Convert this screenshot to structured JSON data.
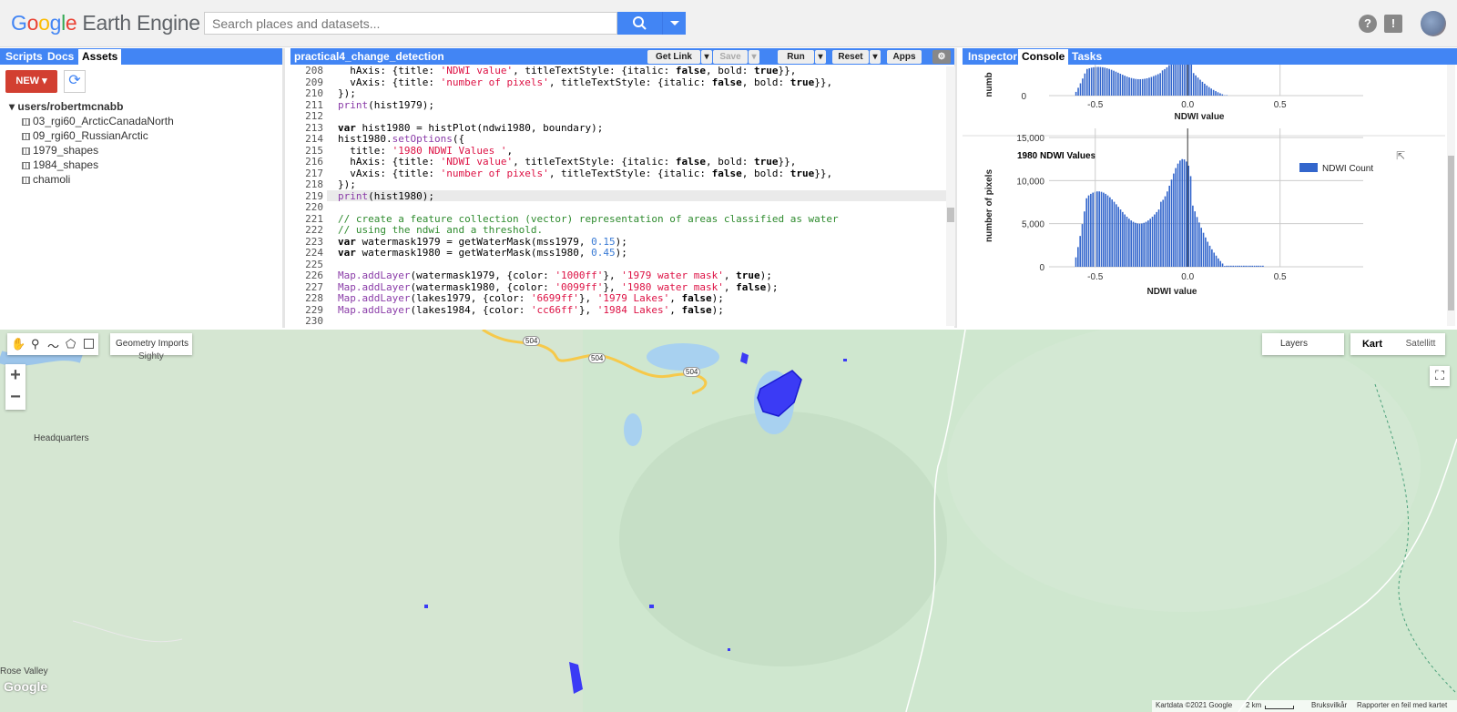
{
  "header": {
    "logo_google": "Google",
    "logo_ee": "Earth Engine",
    "search_placeholder": "Search places and datasets..."
  },
  "left": {
    "tabs": [
      "Scripts",
      "Docs",
      "Assets"
    ],
    "active_tab": "Assets",
    "new_label": "NEW",
    "root": "users/robertmcnabb",
    "items": [
      "03_rgi60_ArcticCanadaNorth",
      "09_rgi60_RussianArctic",
      "1979_shapes",
      "1984_shapes",
      "chamoli"
    ]
  },
  "editor": {
    "script_name": "practical4_change_detection",
    "buttons": {
      "getlink": "Get Link",
      "save": "Save",
      "run": "Run",
      "reset": "Reset",
      "apps": "Apps"
    },
    "lines": [
      {
        "n": "208",
        "html": "  hAxis: {title: <span class='str'>'NDWI value'</span>, titleTextStyle: {italic: <span class='kw'>false</span>, bold: <span class='kw'>true</span>}},"
      },
      {
        "n": "209",
        "html": "  vAxis: {title: <span class='str'>'number of pixels'</span>, titleTextStyle: {italic: <span class='kw'>false</span>, bold: <span class='kw'>true</span>}},"
      },
      {
        "n": "210",
        "html": "});"
      },
      {
        "n": "211",
        "html": "<span class='fn'>print</span>(hist1979);"
      },
      {
        "n": "212",
        "html": ""
      },
      {
        "n": "213",
        "html": "<span class='kw'>var</span> hist1980 = histPlot(ndwi1980, boundary);"
      },
      {
        "n": "214",
        "html": "hist1980.<span class='fn'>setOptions</span>({"
      },
      {
        "n": "215",
        "html": "  title: <span class='str'>'1980 NDWI Values '</span>,"
      },
      {
        "n": "216",
        "html": "  hAxis: {title: <span class='str'>'NDWI value'</span>, titleTextStyle: {italic: <span class='kw'>false</span>, bold: <span class='kw'>true</span>}},"
      },
      {
        "n": "217",
        "html": "  vAxis: {title: <span class='str'>'number of pixels'</span>, titleTextStyle: {italic: <span class='kw'>false</span>, bold: <span class='kw'>true</span>}},"
      },
      {
        "n": "218",
        "html": "});"
      },
      {
        "n": "219",
        "html": "<span class='fn'>print</span>(hist1980);"
      },
      {
        "n": "220",
        "html": ""
      },
      {
        "n": "221",
        "html": "<span class='cm'>// create a feature collection (vector) representation of areas classified as water</span>"
      },
      {
        "n": "222",
        "html": "<span class='cm'>// using the ndwi and a threshold.</span>"
      },
      {
        "n": "223",
        "html": "<span class='kw'>var</span> watermask1979 = getWaterMask(mss1979, <span class='num'>0.15</span>);"
      },
      {
        "n": "224",
        "html": "<span class='kw'>var</span> watermask1980 = getWaterMask(mss1980, <span class='num'>0.45</span>);"
      },
      {
        "n": "225",
        "html": ""
      },
      {
        "n": "226",
        "html": "<span class='fn'>Map.addLayer</span>(watermask1979, {color: <span class='str'>'1000ff'</span>}, <span class='str'>'1979 water mask'</span>, <span class='kw'>true</span>);"
      },
      {
        "n": "227",
        "html": "<span class='fn'>Map.addLayer</span>(watermask1980, {color: <span class='str'>'0099ff'</span>}, <span class='str'>'1980 water mask'</span>, <span class='kw'>false</span>);"
      },
      {
        "n": "228",
        "html": "<span class='fn'>Map.addLayer</span>(lakes1979, {color: <span class='str'>'6699ff'</span>}, <span class='str'>'1979 Lakes'</span>, <span class='kw'>false</span>);"
      },
      {
        "n": "229",
        "html": "<span class='fn'>Map.addLayer</span>(lakes1984, {color: <span class='str'>'cc66ff'</span>}, <span class='str'>'1984 Lakes'</span>, <span class='kw'>false</span>);"
      },
      {
        "n": "230",
        "html": ""
      }
    ]
  },
  "right": {
    "tabs": [
      "Inspector",
      "Console",
      "Tasks"
    ],
    "active_tab": "Console"
  },
  "chart_data": [
    {
      "type": "bar",
      "title": "",
      "xlabel": "NDWI value",
      "ylabel": "numb",
      "x_ticks": [
        "-0.5",
        "0.0",
        "0.5"
      ],
      "y_ticks": [
        "0"
      ],
      "partial": true
    },
    {
      "type": "bar",
      "title": "1980 NDWI Values",
      "xlabel": "NDWI value",
      "ylabel": "number of pixels",
      "legend": "NDWI Count",
      "legend_position": "top-right",
      "x_ticks": [
        "-0.5",
        "0.0",
        "0.5"
      ],
      "y_ticks": [
        "0",
        "5,000",
        "10,000",
        "15,000"
      ],
      "ylim": [
        0,
        15000
      ],
      "xlim": [
        -0.75,
        0.95
      ],
      "series": [
        {
          "name": "NDWI Count",
          "color": "#3366cc"
        }
      ]
    }
  ],
  "map": {
    "geometry_imports": "Geometry Imports",
    "layers": "Layers",
    "kart": "Kart",
    "satellitt": "Satellitt",
    "labels": [
      "Sighty",
      "Headquarters",
      "Rose Valley",
      "504",
      "504",
      "504"
    ],
    "attribution": "Kartdata ©2021 Google",
    "scale": "2 km",
    "terms": "Bruksvilkår",
    "report": "Rapporter en feil med kartet",
    "google": "Google"
  }
}
